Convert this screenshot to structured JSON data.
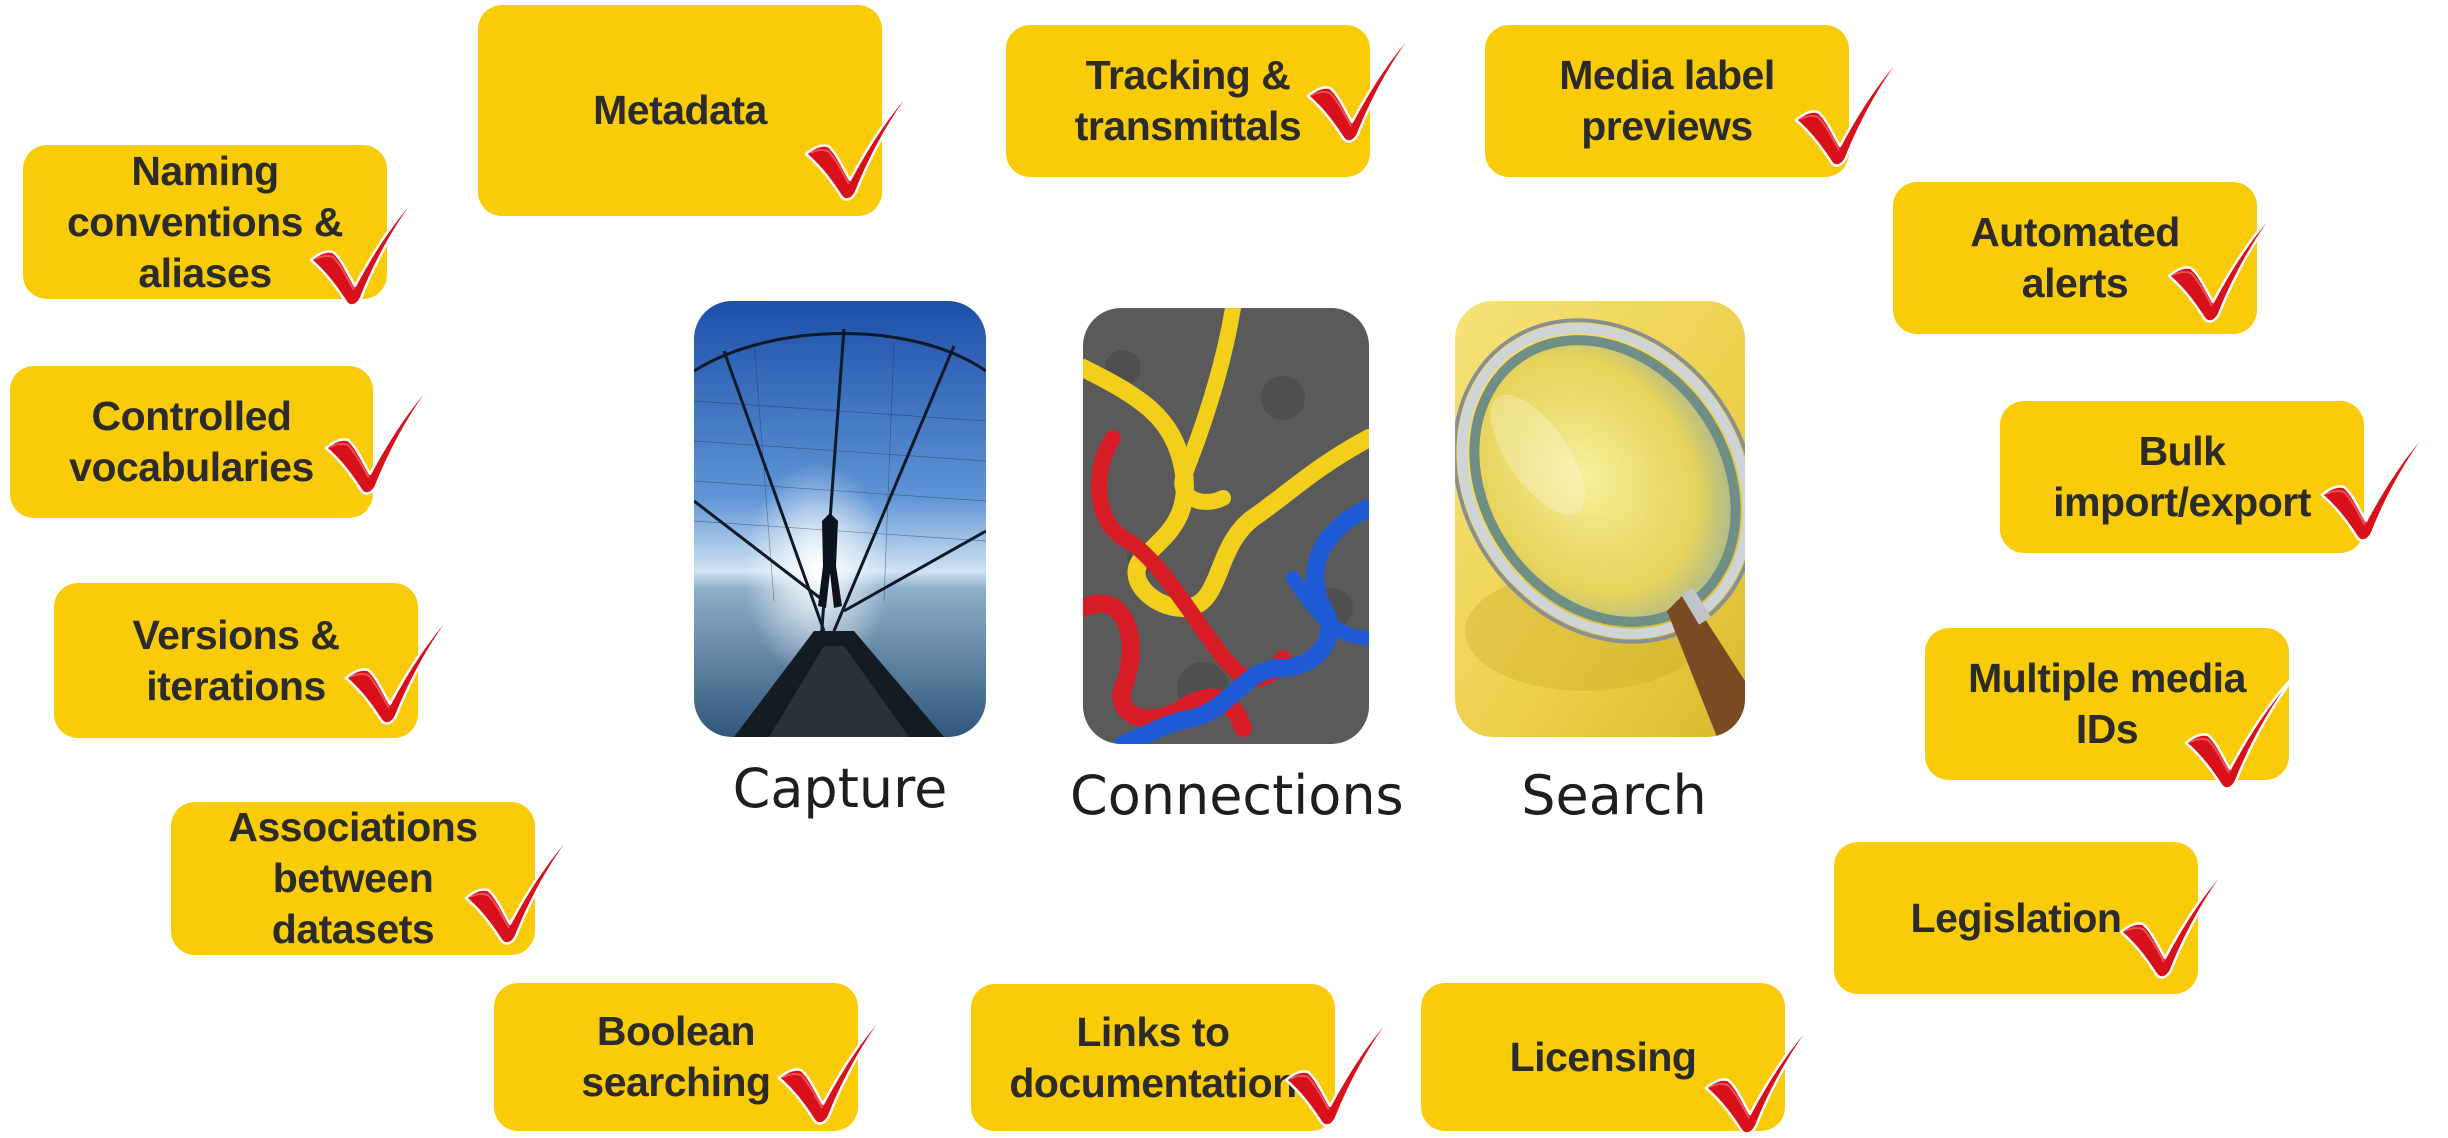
{
  "accent_color": "#F9CB08",
  "check_color": "#E0141E",
  "check_icon": "red-checkmark-icon",
  "features": {
    "metadata": "Metadata",
    "tracking": "Tracking &\ntransmittals",
    "media_label": "Media label\npreviews",
    "naming": "Naming\nconventions &\naliases",
    "automated_alerts": "Automated\nalerts",
    "controlled_vocab": "Controlled\nvocabularies",
    "bulk": "Bulk\nimport/export",
    "versions": "Versions &\niterations",
    "multiple_media": "Multiple media\nIDs",
    "associations": "Associations\nbetween\ndatasets",
    "legislation": "Legislation",
    "boolean": "Boolean\nsearching",
    "links": "Links to\ndocumentation",
    "licensing": "Licensing"
  },
  "pillars": {
    "capture": {
      "caption": "Capture",
      "image": "fisherman-net-photo"
    },
    "connections": {
      "caption": "Connections",
      "image": "tied-ropes-photo"
    },
    "search": {
      "caption": "Search",
      "image": "magnifying-glass-photo"
    }
  }
}
